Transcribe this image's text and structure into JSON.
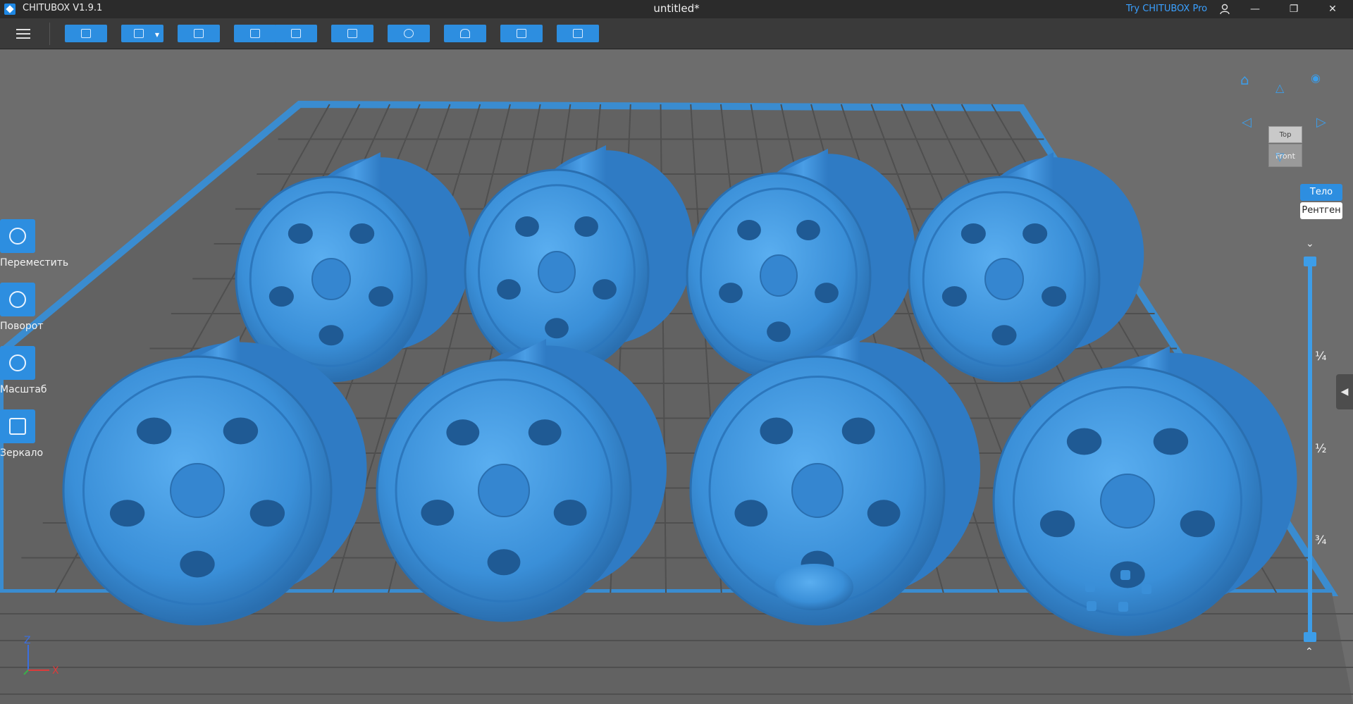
{
  "titlebar": {
    "app_name": "CHITUBOX V1.9.1",
    "doc_title": "untitled*",
    "try_pro": "Try CHITUBOX Pro",
    "minimize": "—",
    "maximize": "❐",
    "close": "✕"
  },
  "toolbar": {
    "buttons": [
      "open-file",
      "save",
      "auto-layout",
      "undo",
      "redo",
      "copy",
      "multiply",
      "supports",
      "hollow",
      "slice"
    ]
  },
  "tools": {
    "move_label": "Переместить",
    "rotate_label": "Поворот",
    "scale_label": "Масштаб",
    "mirror_label": "Зеркало"
  },
  "viewcube": {
    "top_label": "Top",
    "front_label": "Front"
  },
  "view_modes": {
    "solid": "Тело",
    "xray": "Рентген"
  },
  "layer_slider": {
    "ticks": [
      "¼",
      "½",
      "¾"
    ]
  },
  "axis": {
    "z": "Z",
    "x": "X"
  },
  "colors": {
    "accent": "#2d8ee0",
    "model": "#3a8fd8",
    "plate_border": "#3a8cd0",
    "viewport": "#6d6d6d"
  }
}
